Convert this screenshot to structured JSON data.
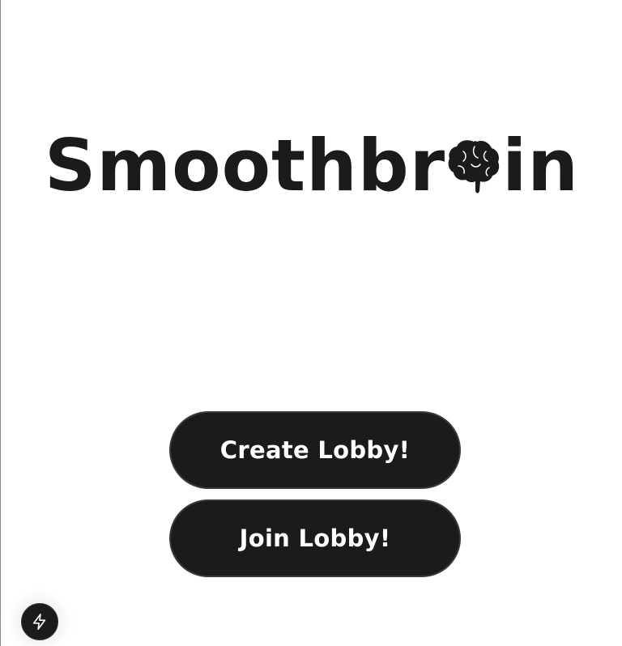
{
  "logo": {
    "text_before": "Smoothbr",
    "icon": "brain-icon",
    "text_after": "in"
  },
  "buttons": {
    "create_label": "Create Lobby!",
    "join_label": "Join Lobby!"
  },
  "dev_tools": {
    "icon": "lightning-bolt-icon"
  },
  "colors": {
    "primary": "#1b1b1d",
    "background": "#ffffff",
    "button_text": "#ffffff"
  }
}
